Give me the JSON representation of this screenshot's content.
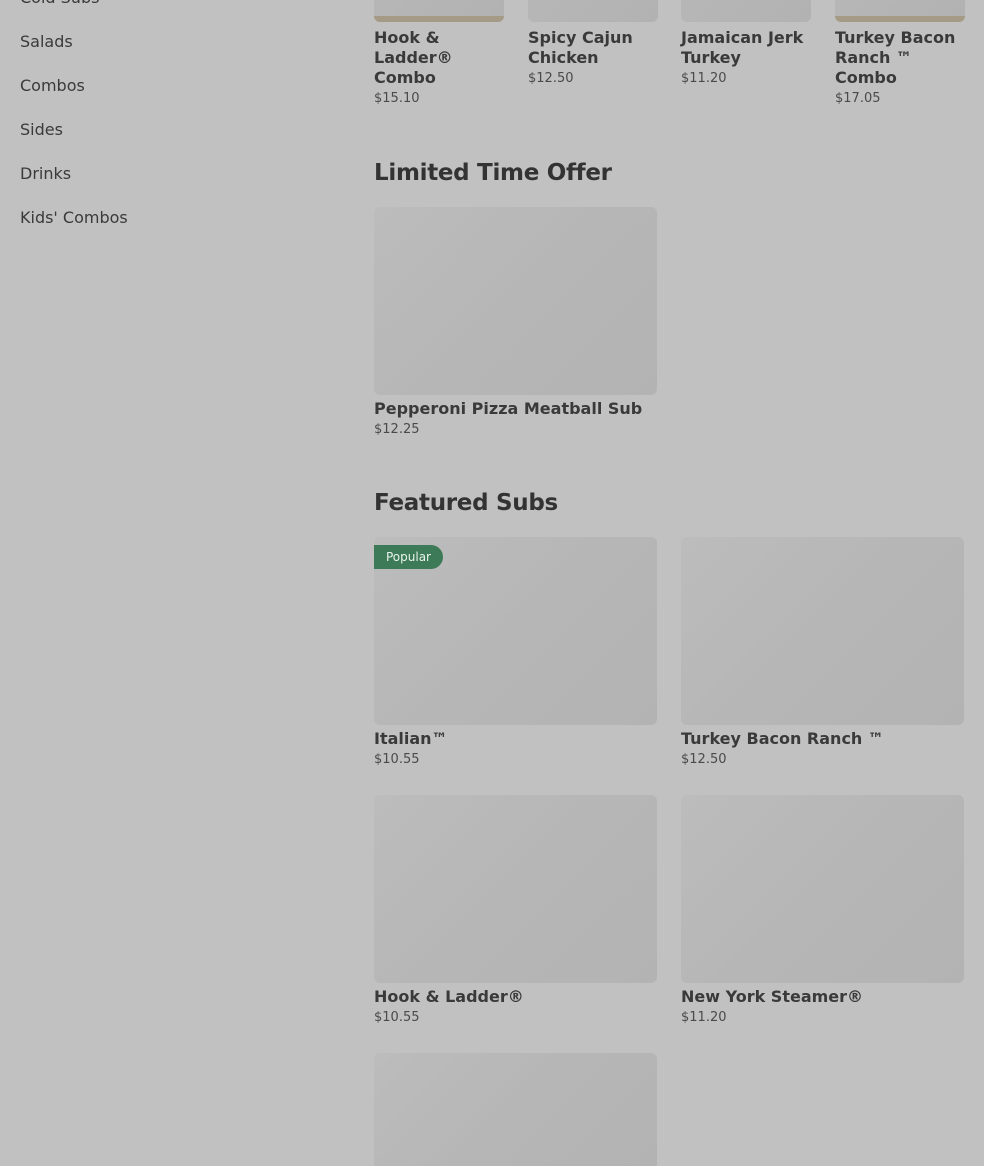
{
  "sidebar": {
    "items": [
      {
        "label": "Cold Subs"
      },
      {
        "label": "Salads"
      },
      {
        "label": "Combos"
      },
      {
        "label": "Sides"
      },
      {
        "label": "Drinks"
      },
      {
        "label": "Kids' Combos"
      }
    ]
  },
  "top_row": [
    {
      "name": "Hook & Ladder® Combo",
      "price": "$15.10"
    },
    {
      "name": "Spicy Cajun Chicken",
      "price": "$12.50"
    },
    {
      "name": "Jamaican Jerk Turkey",
      "price": "$11.20"
    },
    {
      "name": "Turkey Bacon Ranch ™ Combo",
      "price": "$17.05"
    }
  ],
  "limited": {
    "title": "Limited Time Offer",
    "items": [
      {
        "name": "Pepperoni Pizza Meatball Sub",
        "price": "$12.25"
      }
    ]
  },
  "featured": {
    "title": "Featured Subs",
    "badge": "Popular",
    "items": [
      {
        "name": "Italian™",
        "price": "$10.55"
      },
      {
        "name": "Turkey Bacon Ranch ™",
        "price": "$12.50"
      },
      {
        "name": "Hook & Ladder®",
        "price": "$10.55"
      },
      {
        "name": "New York Steamer®",
        "price": "$11.20"
      }
    ]
  }
}
